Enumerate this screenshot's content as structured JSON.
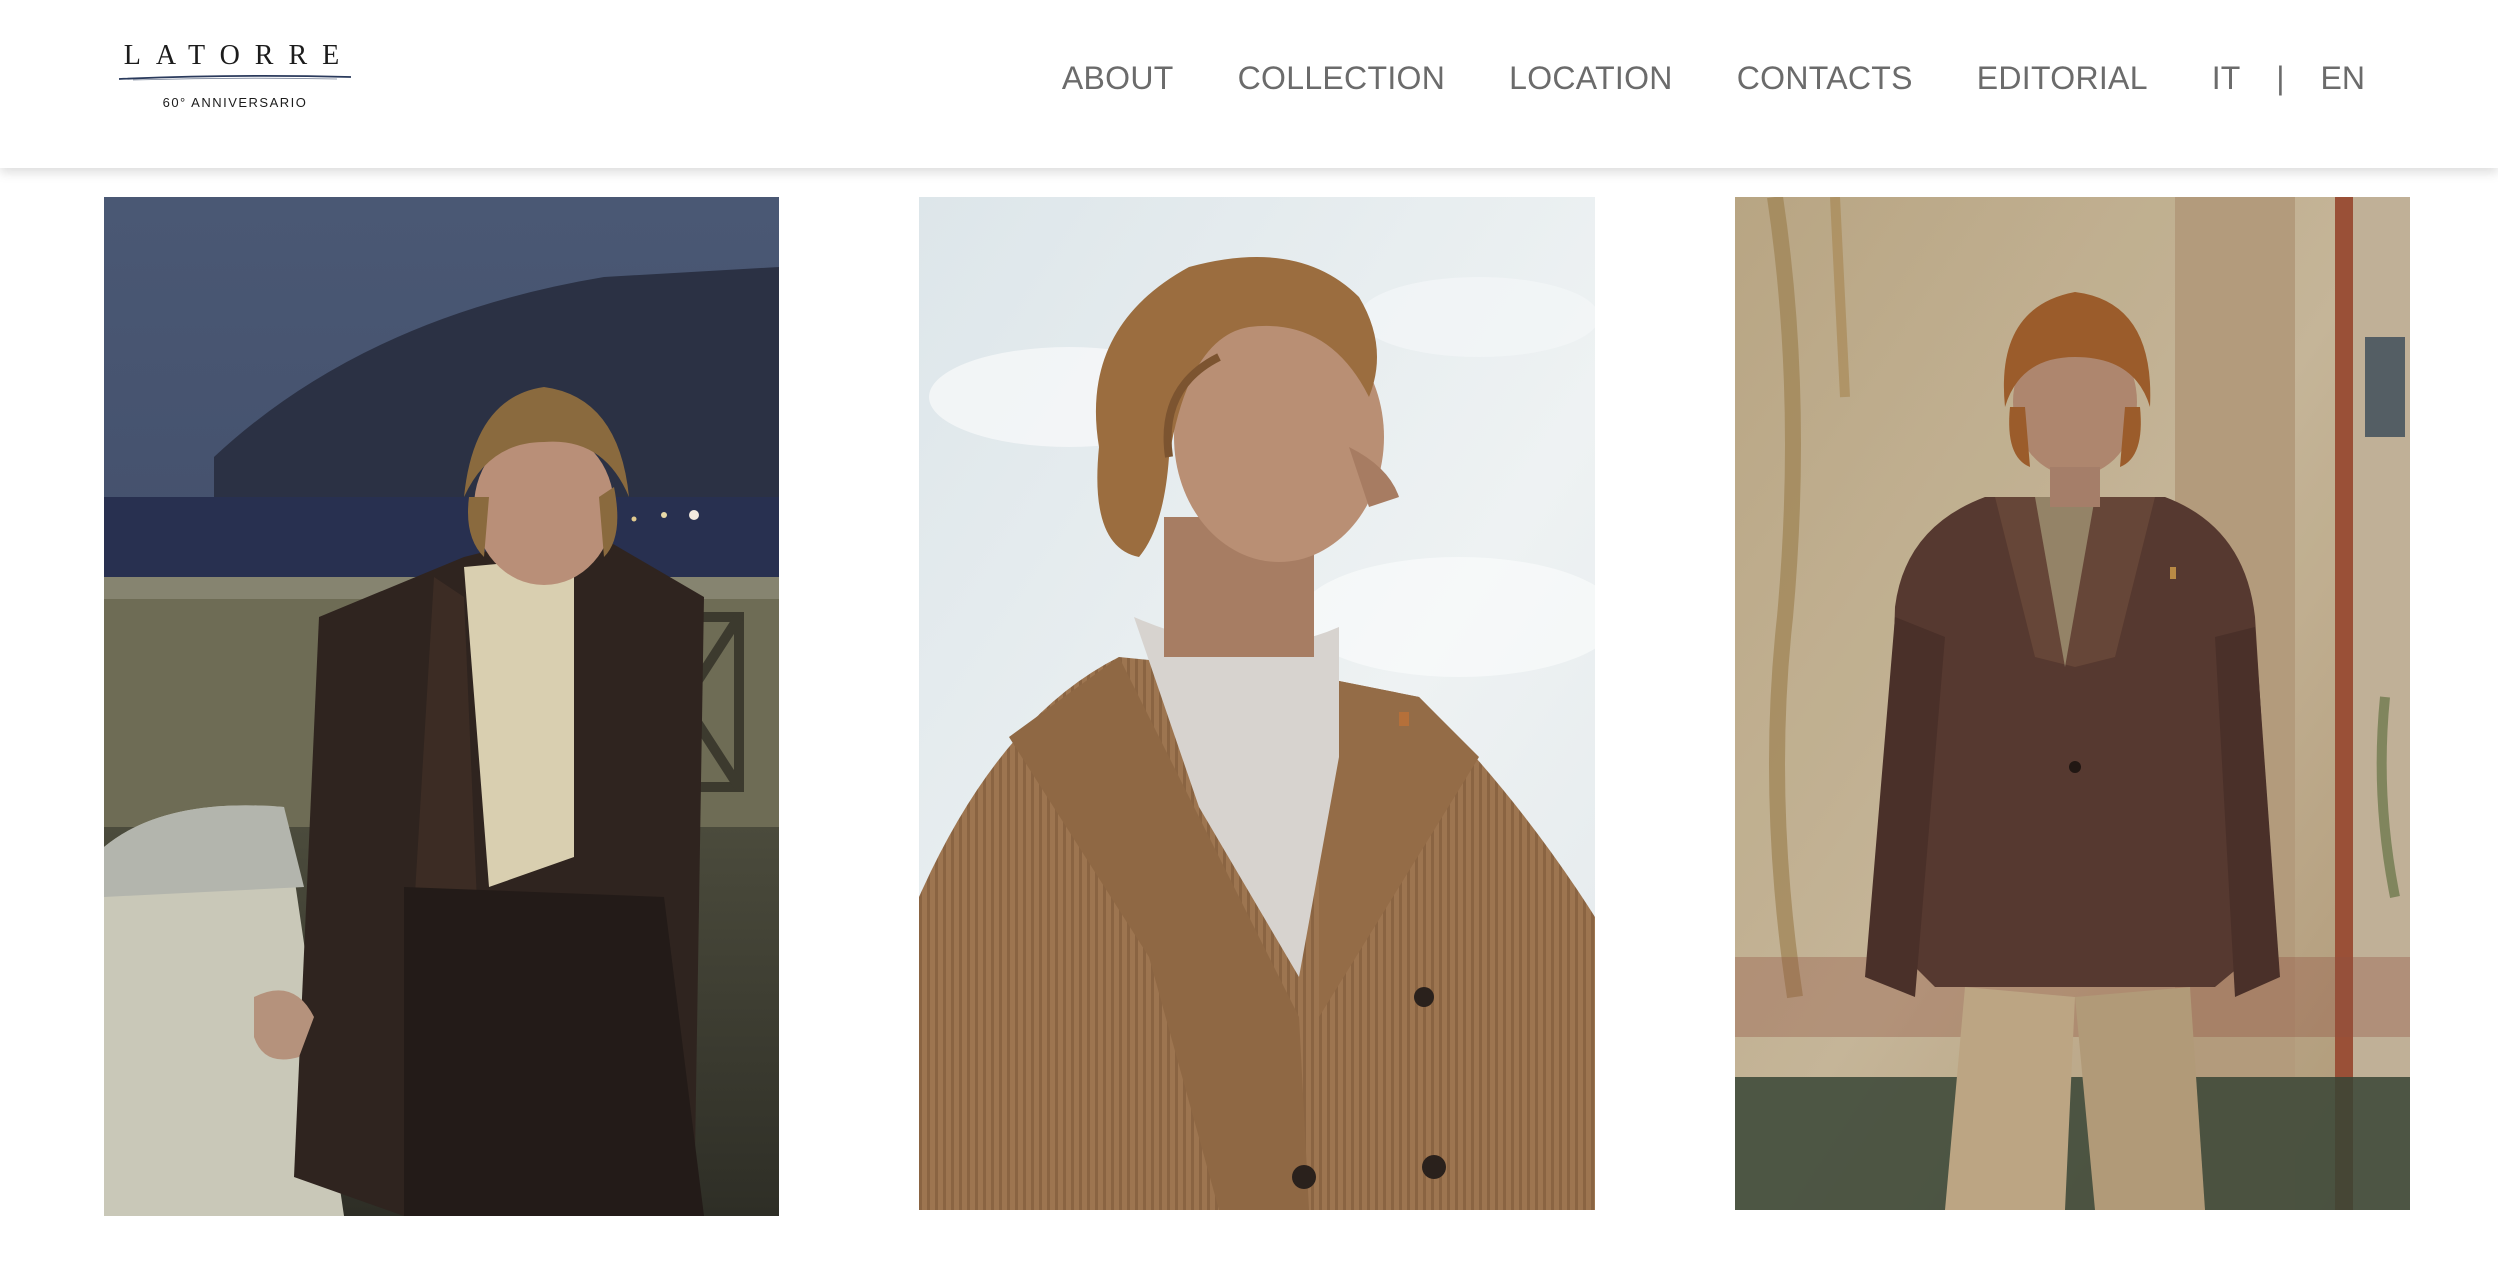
{
  "brand": {
    "name": "LATORRE",
    "tagline": "60° ANNIVERSARIO"
  },
  "nav": {
    "items": [
      {
        "label": "ABOUT"
      },
      {
        "label": "COLLECTION"
      },
      {
        "label": "LOCATION"
      },
      {
        "label": "CONTACTS"
      },
      {
        "label": "EDITORIAL"
      }
    ],
    "languages": {
      "it": "IT",
      "separator": "|",
      "en": "EN"
    }
  },
  "colors": {
    "nav_text": "#6b6b6b",
    "header_bg": "#ffffff"
  },
  "gallery": {
    "photos": [
      {
        "icon": "photo-model-seated-terrace-night"
      },
      {
        "icon": "photo-model-profile-corduroy-jacket"
      },
      {
        "icon": "photo-model-standing-fresco-wall"
      }
    ]
  }
}
